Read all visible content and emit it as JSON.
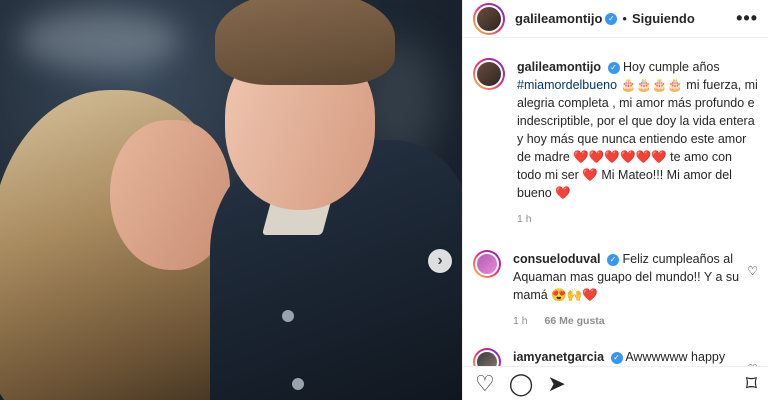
{
  "post": {
    "username": "galileamontijo",
    "follow_status": "Siguiendo",
    "caption_user": "galileamontijo",
    "caption_pre": "Hoy cumple años",
    "caption_tag": "#miamordelbueno",
    "caption_cakes": "🎂🎂🎂🎂",
    "caption_mid": " mi fuerza, mi alegria completa , mi amor más profundo e indescriptible, por el que doy la vida entera y hoy más que nunca entiendo este amor de madre ",
    "caption_hearts": "❤️❤️❤️❤️❤️❤️",
    "caption_end": " te amo con todo mi ser ",
    "caption_heart2": "❤️",
    "caption_end2": " Mi Mateo!!! Mi amor del bueno ",
    "caption_heart3": "❤️",
    "time": "1 h"
  },
  "comments": [
    {
      "user": "consueloduval",
      "text": "Feliz cumpleaños al Aquaman mas guapo del mundo!! Y a su mamá",
      "emoji": "😍🙌❤️",
      "time": "1 h",
      "likes": "66 Me gusta"
    },
    {
      "user": "iamyanetgarcia",
      "text": "Awwwwww happy"
    }
  ],
  "icons": {
    "verified": "verified-badge-icon",
    "more": "more-options-icon",
    "like": "heart-icon",
    "comment": "comment-icon",
    "share": "share-icon",
    "save": "bookmark-icon",
    "next": "chevron-right-icon"
  },
  "glyphs": {
    "more": "•••",
    "dot": "•",
    "verified": "✓",
    "next": "›",
    "heart": "♡",
    "comment": "◯",
    "share": "➤",
    "save": "⌑",
    "small_heart": "♡"
  },
  "colors": {
    "verified": "#3897f0",
    "link": "#00376b",
    "muted": "#8e8e8e"
  }
}
